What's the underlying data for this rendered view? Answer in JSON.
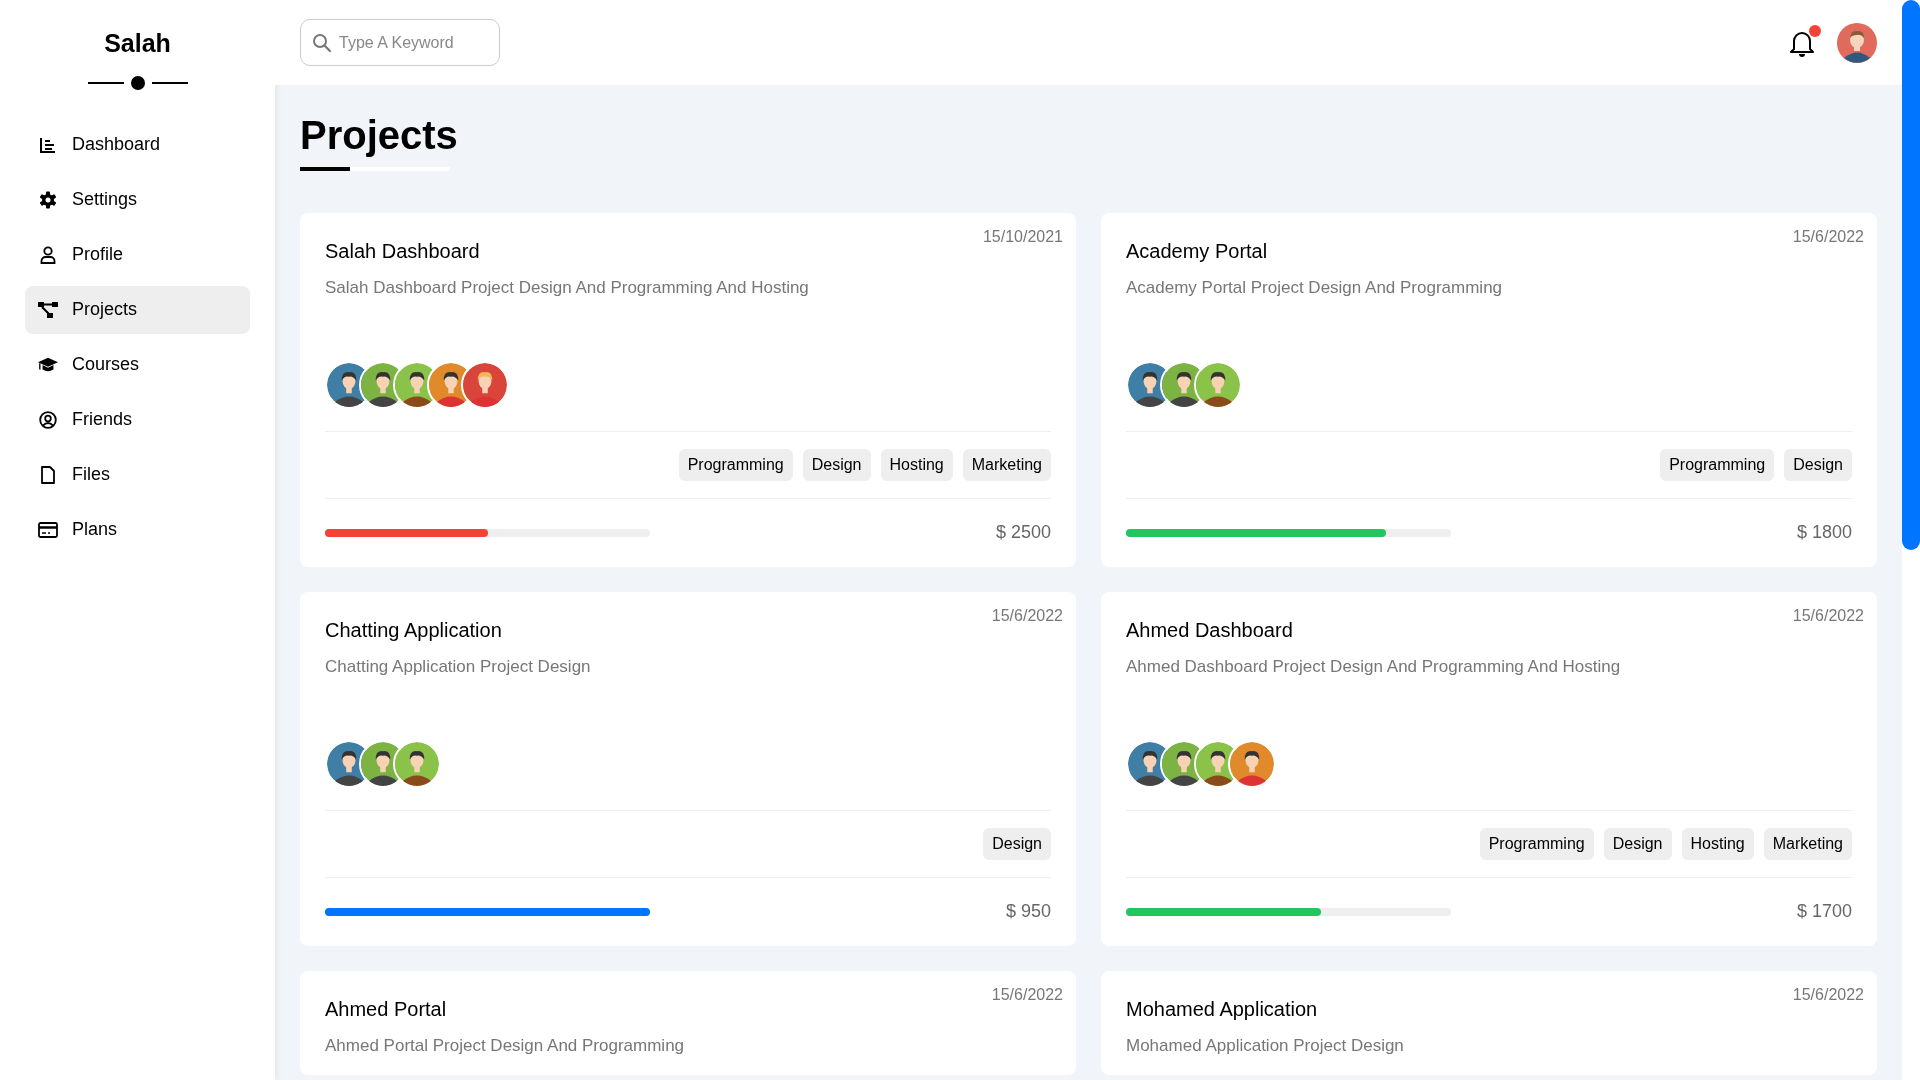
{
  "sidebar": {
    "logo": "Salah",
    "items": [
      {
        "label": "Dashboard",
        "selected": false
      },
      {
        "label": "Settings",
        "selected": false
      },
      {
        "label": "Profile",
        "selected": false
      },
      {
        "label": "Projects",
        "selected": true
      },
      {
        "label": "Courses",
        "selected": false
      },
      {
        "label": "Friends",
        "selected": false
      },
      {
        "label": "Files",
        "selected": false
      },
      {
        "label": "Plans",
        "selected": false
      }
    ]
  },
  "search": {
    "placeholder": "Type A Keyword"
  },
  "header": {
    "notification_dot": true
  },
  "page_title": "Projects",
  "projects": [
    {
      "title": "Salah Dashboard",
      "date": "15/10/2021",
      "description": "Salah Dashboard Project Design And Programming And Hosting",
      "members": [
        {
          "color": "#3f7fa6"
        },
        {
          "color": "#7cb342"
        },
        {
          "color": "#8bc34a"
        },
        {
          "color": "#e08a2c"
        },
        {
          "color": "#d9443b"
        }
      ],
      "tags": [
        "Programming",
        "Design",
        "Hosting",
        "Marketing"
      ],
      "color": "#f44336",
      "level": 0.5,
      "price": "$ 2500"
    },
    {
      "title": "Academy Portal",
      "date": "15/6/2022",
      "description": "Academy Portal Project Design And Programming",
      "members": [
        {
          "color": "#3f7fa6"
        },
        {
          "color": "#7cb342"
        },
        {
          "color": "#8bc34a"
        }
      ],
      "tags": [
        "Programming",
        "Design"
      ],
      "color": "#22c55e",
      "level": 0.8,
      "price": "$ 1800"
    },
    {
      "title": "Chatting Application",
      "date": "15/6/2022",
      "description": "Chatting Application Project Design",
      "members": [
        {
          "color": "#3f7fa6"
        },
        {
          "color": "#7cb342"
        },
        {
          "color": "#8bc34a"
        }
      ],
      "tags": [
        "Design"
      ],
      "color": "#0075ff",
      "level": 1,
      "price": "$ 950"
    },
    {
      "title": "Ahmed Dashboard",
      "date": "15/6/2022",
      "description": "Ahmed Dashboard Project Design And Programming And Hosting",
      "members": [
        {
          "color": "#3f7fa6"
        },
        {
          "color": "#7cb342"
        },
        {
          "color": "#8bc34a"
        },
        {
          "color": "#e08a2c"
        }
      ],
      "tags": [
        "Programming",
        "Design",
        "Hosting",
        "Marketing"
      ],
      "color": "#22c55e",
      "level": 0.6,
      "price": "$ 1700"
    },
    {
      "title": "Ahmed Portal",
      "date": "15/6/2022",
      "description": "Ahmed Portal Project Design And Programming"
    },
    {
      "title": "Mohamed Application",
      "date": "15/6/2022",
      "description": "Mohamed Application Project Design"
    }
  ]
}
